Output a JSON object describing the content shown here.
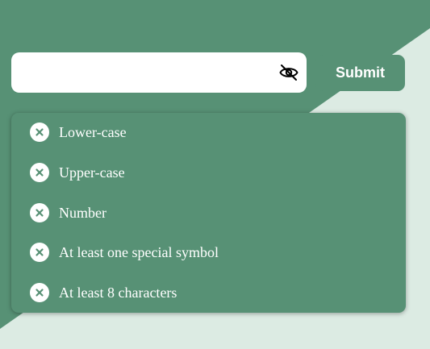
{
  "password": {
    "value": "",
    "placeholder": "",
    "toggle_icon": "eye-slash-icon"
  },
  "submit": {
    "label": "Submit"
  },
  "requirements": [
    {
      "label": "Lower-case",
      "status": "unmet",
      "icon": "x-icon"
    },
    {
      "label": "Upper-case",
      "status": "unmet",
      "icon": "x-icon"
    },
    {
      "label": "Number",
      "status": "unmet",
      "icon": "x-icon"
    },
    {
      "label": "At least one special symbol",
      "status": "unmet",
      "icon": "x-icon"
    },
    {
      "label": "At least 8 characters",
      "status": "unmet",
      "icon": "x-icon"
    }
  ],
  "colors": {
    "primary": "#579175",
    "background_light": "#dcebe3",
    "text_light": "#ffffff"
  }
}
